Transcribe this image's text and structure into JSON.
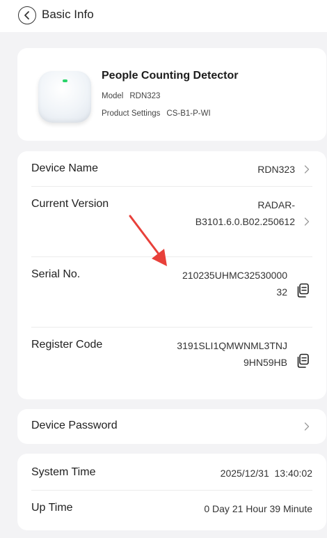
{
  "header": {
    "title": "Basic Info"
  },
  "product": {
    "name": "People Counting Detector",
    "model_label": "Model",
    "model_value": "RDN323",
    "settings_label": "Product Settings",
    "settings_value": "CS-B1-P-WI"
  },
  "info": {
    "device_name": {
      "label": "Device Name",
      "value": "RDN323"
    },
    "current_version": {
      "label": "Current Version",
      "value_line1": "RADAR-",
      "value_line2": "B3101.6.0.B02.250612"
    },
    "serial": {
      "label": "Serial No.",
      "value_line1": "210235UHMC32530000",
      "value_line2": "32"
    },
    "register": {
      "label": "Register Code",
      "value_line1": "3191SLI1QMWNML3TNJ",
      "value_line2": "9HN59HB"
    }
  },
  "password": {
    "label": "Device Password"
  },
  "time": {
    "system_time": {
      "label": "System Time",
      "value": "2025/12/31  13:40:02"
    },
    "up_time": {
      "label": "Up Time",
      "value": "0 Day 21 Hour 39 Minute"
    }
  },
  "colors": {
    "background": "#f3f3f5",
    "card": "#ffffff",
    "arrow": "#e8403a",
    "led": "#2ad36a"
  },
  "icons": [
    "back-circle-icon",
    "chevron-right-icon",
    "copy-icon",
    "annotation-arrow"
  ]
}
